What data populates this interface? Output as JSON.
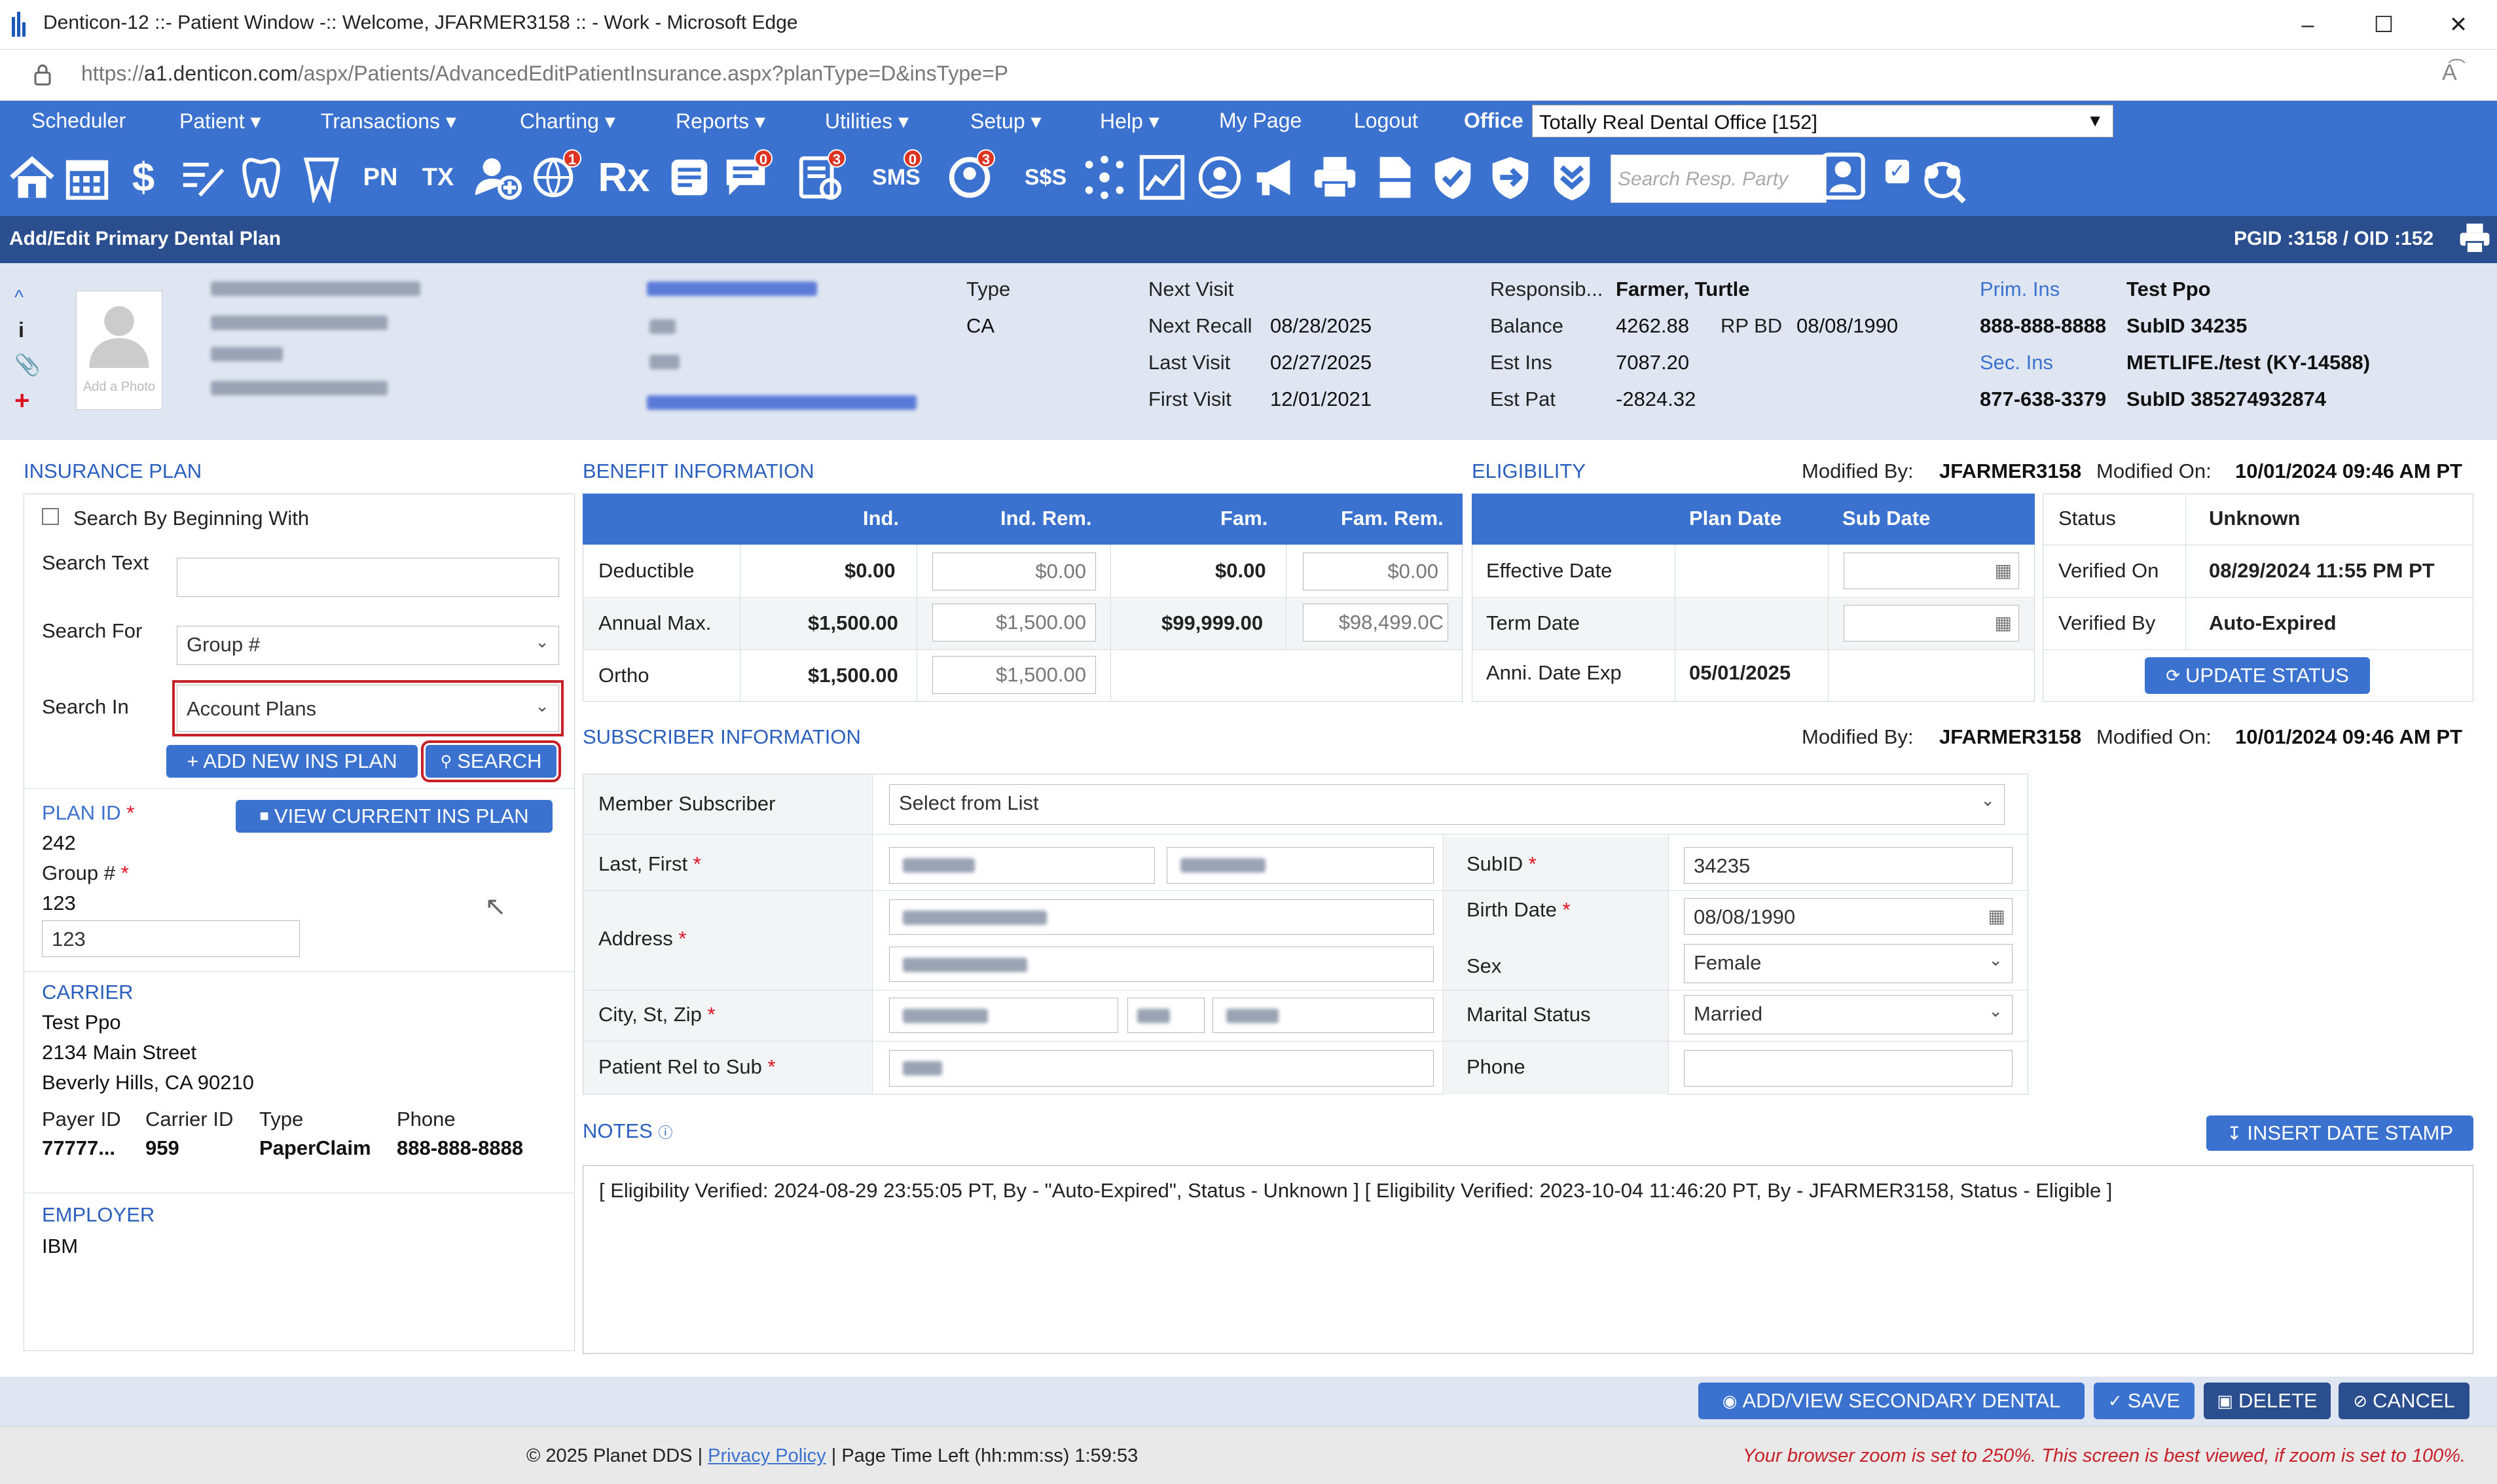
{
  "window": {
    "title": "Denticon-12 ::- Patient Window -:: Welcome, JFARMER3158 :: - Work - Microsoft Edge",
    "url_prefix": "https://",
    "url_host": "a1.denticon.com",
    "url_path": "/aspx/Patients/AdvancedEditPatientInsurance.aspx?planType=D&insType=P"
  },
  "menu": {
    "items": [
      "Scheduler",
      "Patient ▾",
      "Transactions ▾",
      "Charting ▾",
      "Reports ▾",
      "Utilities ▾",
      "Setup ▾",
      "Help ▾",
      "My Page",
      "Logout"
    ],
    "office_label": "Office",
    "office_value": "Totally Real Dental Office [152]"
  },
  "toolbar": {
    "pn_label": "PN",
    "tx_label": "TX",
    "rx_label": "Rx",
    "sms_label": "SMS",
    "badges": {
      "globe": "1",
      "chat": "0",
      "tasks": "3",
      "sms": "0",
      "recall": "3"
    },
    "search_placeholder": "Search Resp. Party"
  },
  "header": {
    "title": "Add/Edit Primary Dental Plan",
    "ids": "PGID :3158  /  OID :152"
  },
  "patient": {
    "photo_label": "Add a Photo",
    "type_label": "Type",
    "type_value": "CA",
    "next_visit_label": "Next Visit",
    "next_recall_label": "Next Recall",
    "next_recall": "08/28/2025",
    "last_visit_label": "Last Visit",
    "last_visit": "02/27/2025",
    "first_visit_label": "First Visit",
    "first_visit": "12/01/2021",
    "resp_label": "Responsib...",
    "resp_value": "Farmer, Turtle",
    "balance_label": "Balance",
    "balance": "4262.88",
    "rpbd_label": "RP BD",
    "rpbd": "08/08/1990",
    "est_ins_label": "Est Ins",
    "est_ins": "7087.20",
    "est_pat_label": "Est Pat",
    "est_pat": "-2824.32",
    "prim_ins_label": "Prim. Ins",
    "prim_ins": "Test Ppo",
    "prim_phone": "888-888-8888",
    "prim_subid": "SubID 34235",
    "sec_ins_label": "Sec. Ins",
    "sec_ins": "METLIFE./test (KY-14588)",
    "sec_phone": "877-638-3379",
    "sec_subid": "SubID 385274932874"
  },
  "insurance_plan": {
    "title": "INSURANCE PLAN",
    "search_beginning": "Search By Beginning With",
    "search_text_label": "Search Text",
    "search_text_value": "",
    "search_for_label": "Search For",
    "search_for_value": "Group #",
    "search_in_label": "Search In",
    "search_in_value": "Account Plans",
    "add_new_btn": "+ ADD NEW INS PLAN",
    "search_btn": "SEARCH",
    "plan_id_label": "PLAN ID",
    "view_current_btn": "VIEW CURRENT INS PLAN",
    "plan_id": "242",
    "group_label": "Group #",
    "group_value": "123",
    "group_input": "123",
    "carrier_title": "CARRIER",
    "carrier_name": "Test Ppo",
    "carrier_addr1": "2134 Main Street",
    "carrier_addr2": "Beverly Hills, CA 90210",
    "payer_id_label": "Payer ID",
    "carrier_id_label": "Carrier ID",
    "type_label": "Type",
    "phone_label": "Phone",
    "payer_id": "77777...",
    "carrier_id": "959",
    "type": "PaperClaim",
    "phone": "888-888-8888",
    "employer_title": "EMPLOYER",
    "employer": "IBM"
  },
  "benefit": {
    "title": "BENEFIT INFORMATION",
    "headers": [
      "Ind.",
      "Ind. Rem.",
      "Fam.",
      "Fam. Rem."
    ],
    "rows": [
      {
        "label": "Deductible",
        "ind": "$0.00",
        "ind_rem": "$0.00",
        "fam": "$0.00",
        "fam_rem": "$0.00"
      },
      {
        "label": "Annual Max.",
        "ind": "$1,500.00",
        "ind_rem": "$1,500.00",
        "fam": "$99,999.00",
        "fam_rem": "$98,499.0C"
      },
      {
        "label": "Ortho",
        "ind": "$1,500.00",
        "ind_rem": "$1,500.00",
        "fam": "",
        "fam_rem": ""
      }
    ]
  },
  "eligibility": {
    "title": "ELIGIBILITY",
    "modified_by_label": "Modified By:",
    "modified_by": "JFARMER3158",
    "modified_on_label": "Modified On:",
    "modified_on": "10/01/2024 09:46 AM PT",
    "plan_date_header": "Plan Date",
    "sub_date_header": "Sub Date",
    "effective_label": "Effective Date",
    "term_label": "Term Date",
    "anni_label": "Anni. Date Exp",
    "anni_value": "05/01/2025",
    "status_label": "Status",
    "status_value": "Unknown",
    "verified_on_label": "Verified On",
    "verified_on": "08/29/2024 11:55 PM PT",
    "verified_by_label": "Verified By",
    "verified_by": "Auto-Expired",
    "update_btn": "UPDATE STATUS"
  },
  "subscriber": {
    "title": "SUBSCRIBER INFORMATION",
    "modified_by_label": "Modified By:",
    "modified_by": "JFARMER3158",
    "modified_on_label": "Modified On:",
    "modified_on": "10/01/2024 09:46 AM PT",
    "member_label": "Member Subscriber",
    "member_value": "Select from List",
    "last_first_label": "Last, First",
    "address_label": "Address",
    "city_label": "City, St, Zip",
    "rel_label": "Patient Rel to Sub",
    "subid_label": "SubID",
    "subid_value": "34235",
    "birth_label": "Birth Date",
    "birth_value": "08/08/1990",
    "sex_label": "Sex",
    "sex_value": "Female",
    "marital_label": "Marital Status",
    "marital_value": "Married",
    "phone_label": "Phone",
    "phone_value": ""
  },
  "notes": {
    "title": "NOTES",
    "insert_btn": "INSERT DATE STAMP",
    "text": "[ Eligibility Verified: 2024-08-29 23:55:05 PT, By - \"Auto-Expired\", Status - Unknown ] [ Eligibility Verified: 2023-10-04 11:46:20 PT, By - JFARMER3158, Status - Eligible ]"
  },
  "footer": {
    "add_secondary_btn": "ADD/VIEW SECONDARY DENTAL",
    "save_btn": "SAVE",
    "delete_btn": "DELETE",
    "cancel_btn": "CANCEL"
  },
  "status": {
    "copyright": "© 2025 Planet DDS |",
    "privacy": "Privacy Policy",
    "time_left": "| Page Time Left (hh:mm:ss) 1:59:53",
    "zoom_warning": "Your browser zoom is set to 250%. This screen is best viewed, if zoom is set to 100%."
  },
  "colors": {
    "accent": "#3b72cf",
    "header": "#2b4f8e",
    "band": "#dfe6f1",
    "warning": "#c62028"
  }
}
